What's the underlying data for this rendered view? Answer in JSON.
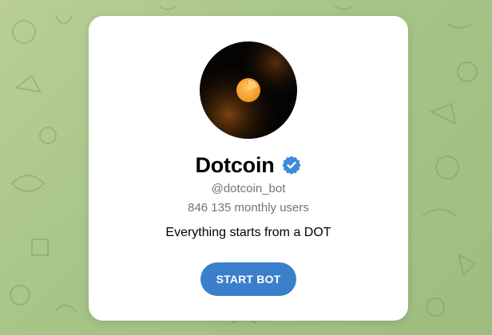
{
  "bot": {
    "title": "Dotcoin",
    "username": "@dotcoin_bot",
    "monthly_users": "846 135 monthly users",
    "description": "Everything starts from a DOT",
    "verified": true
  },
  "actions": {
    "start_label": "START BOT"
  },
  "icons": {
    "verified": "verified-badge-icon",
    "avatar": "dotcoin-logo"
  },
  "colors": {
    "background": "#a7c487",
    "card": "#ffffff",
    "accent": "#3b7fcc",
    "verified": "#3d8bd9",
    "muted_text": "#707579",
    "coin": "#f6a93b"
  }
}
